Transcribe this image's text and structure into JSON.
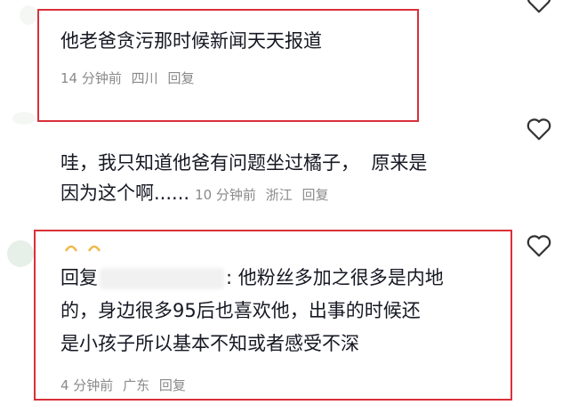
{
  "comments": [
    {
      "text": "他老爸贪污那时候新闻天天报道",
      "time": "14 分钟前",
      "location": "四川",
      "reply_label": "回复"
    },
    {
      "text_line1": "哇，我只知道他爸有问题坐过橘子，  原来是",
      "text_line2": "因为这个啊......",
      "time": "10 分钟前",
      "location": "浙江",
      "reply_label": "回复"
    },
    {
      "reply_prefix": "回复",
      "text_line1_tail": ": 他粉丝多加之很多是内地",
      "text_line2": "的，身边很多95后也喜欢他，出事的时候还",
      "text_line3": "是小孩子所以基本不知或者感受不深",
      "time": "4 分钟前",
      "location": "广东",
      "reply_label": "回复"
    }
  ],
  "colors": {
    "highlight": "#d9303a",
    "meta": "#8a8a8a",
    "text": "#161823"
  },
  "icons": [
    "heart-outline-icon"
  ]
}
